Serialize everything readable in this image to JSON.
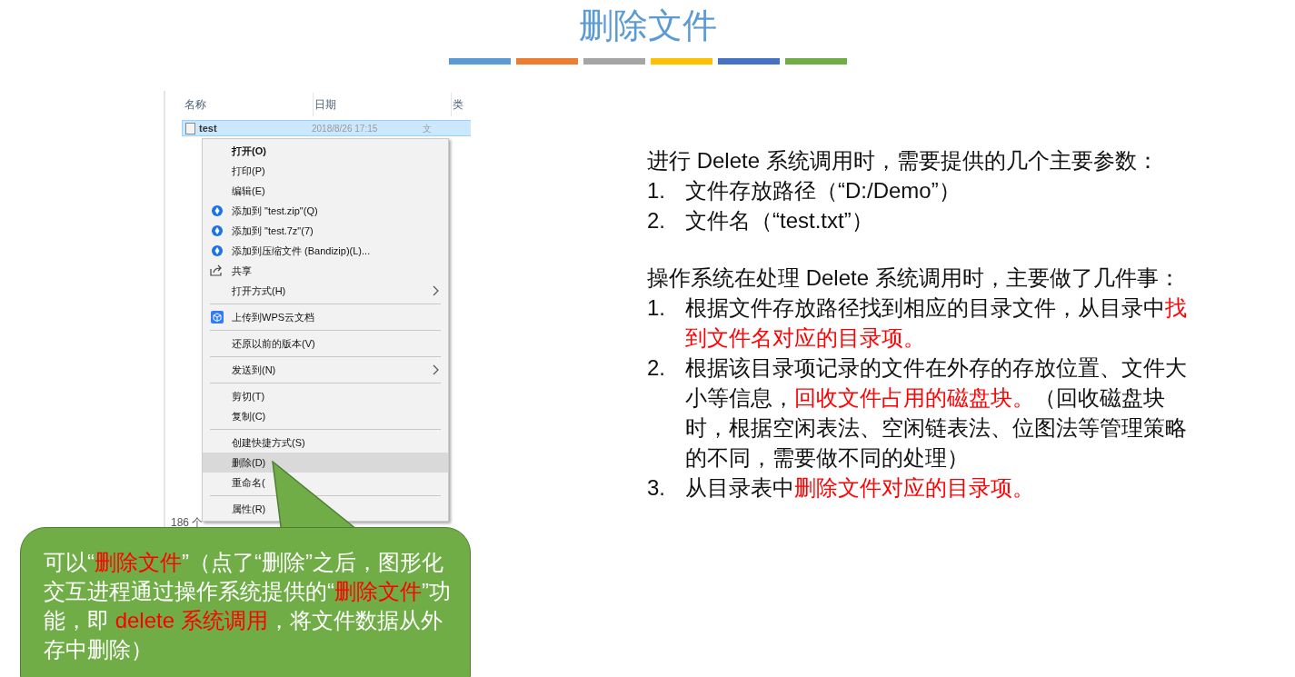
{
  "title": "删除文件",
  "title_bars": [
    {
      "color": "#5b9bd5"
    },
    {
      "color": "#ed7d31"
    },
    {
      "color": "#a5a5a5"
    },
    {
      "color": "#ffc000"
    },
    {
      "color": "#4472c4"
    },
    {
      "color": "#70ad47"
    }
  ],
  "explorer": {
    "columns": [
      "名称",
      "日期",
      "类"
    ],
    "row": {
      "name": "test",
      "date": "2018/8/26 17:15",
      "type": "文",
      "selected": true
    },
    "status_bar": "186 个"
  },
  "context_menu": {
    "groups": [
      [
        {
          "label": "打开(O)",
          "bold": true,
          "selected": false,
          "submenu": false
        },
        {
          "label": "打印(P)",
          "bold": false,
          "selected": false,
          "submenu": false
        },
        {
          "label": "编辑(E)",
          "bold": false,
          "selected": false,
          "submenu": false
        },
        {
          "label": "添加到 \"test.zip\"(Q)",
          "bold": false,
          "selected": false,
          "submenu": false,
          "kind": "archive"
        },
        {
          "label": "添加到 \"test.7z\"(7)",
          "bold": false,
          "selected": false,
          "submenu": false,
          "kind": "archive"
        },
        {
          "label": "添加到压缩文件 (Bandizip)(L)...",
          "bold": false,
          "selected": false,
          "submenu": false,
          "kind": "archive"
        },
        {
          "label": "共享",
          "bold": false,
          "selected": false,
          "submenu": false,
          "kind": "share"
        },
        {
          "label": "打开方式(H)",
          "bold": false,
          "selected": false,
          "submenu": true
        }
      ],
      [
        {
          "label": "上传到WPS云文档",
          "bold": false,
          "selected": false,
          "submenu": false,
          "kind": "cloud"
        }
      ],
      [
        {
          "label": "还原以前的版本(V)",
          "bold": false,
          "selected": false,
          "submenu": false
        }
      ],
      [
        {
          "label": "发送到(N)",
          "bold": false,
          "selected": false,
          "submenu": true
        }
      ],
      [
        {
          "label": "剪切(T)",
          "bold": false,
          "selected": false,
          "submenu": false
        },
        {
          "label": "复制(C)",
          "bold": false,
          "selected": false,
          "submenu": false
        }
      ],
      [
        {
          "label": "创建快捷方式(S)",
          "bold": false,
          "selected": false,
          "submenu": false
        },
        {
          "label": "删除(D)",
          "bold": false,
          "selected": true,
          "submenu": false
        },
        {
          "label": "重命名(",
          "bold": false,
          "selected": false,
          "submenu": false
        }
      ],
      [
        {
          "label": "属性(R)",
          "bold": false,
          "selected": false,
          "submenu": false
        }
      ]
    ]
  },
  "callout": {
    "segments": [
      {
        "text": "可以“",
        "red": false
      },
      {
        "text": "删除文件",
        "red": true
      },
      {
        "text": "”（点了“删除”之后，图形化交互进程通过操作系统提供的“",
        "red": false
      },
      {
        "text": "删除文件",
        "red": true
      },
      {
        "text": "”功能，即 ",
        "red": false
      },
      {
        "text": "delete 系统调用",
        "red": true
      },
      {
        "text": "，将文件数据从外存中删除）",
        "red": false
      }
    ]
  },
  "explanation": [
    {
      "kind": "intro",
      "segments": [
        {
          "text": "进行 Delete 系统调用时，需要提供的几个主要参数：",
          "red": false
        }
      ]
    },
    {
      "kind": "list",
      "items": [
        {
          "number": "1.",
          "segments": [
            {
              "text": "文件存放路径（“D:/Demo”）",
              "red": false
            }
          ]
        },
        {
          "number": "2.",
          "segments": [
            {
              "text": "文件名（“test.txt”）",
              "red": false
            }
          ]
        }
      ]
    },
    {
      "kind": "intro",
      "segments": [
        {
          "text": "操作系统在处理 Delete 系统调用时，主要做了几件事：",
          "red": false
        }
      ]
    },
    {
      "kind": "list",
      "items": [
        {
          "number": "1.",
          "segments": [
            {
              "text": "根据文件存放路径找到相应的目录文件，从目录中",
              "red": false
            },
            {
              "text": "找到文件名对应的目录项。",
              "red": true
            }
          ]
        },
        {
          "number": "2.",
          "segments": [
            {
              "text": "根据该目录项记录的文件在外存的存放位置、文件大小等信息，",
              "red": false
            },
            {
              "text": "回收文件占用的磁盘块。",
              "red": true
            },
            {
              "text": "（回收磁盘块时，根据空闲表法、空闲链表法、位图法等管理策略的不同，需要做不同的处理）",
              "red": false
            }
          ]
        },
        {
          "number": "3.",
          "segments": [
            {
              "text": "从目录表中",
              "red": false
            },
            {
              "text": "删除文件对应的目录项。",
              "red": true
            }
          ]
        }
      ]
    }
  ]
}
